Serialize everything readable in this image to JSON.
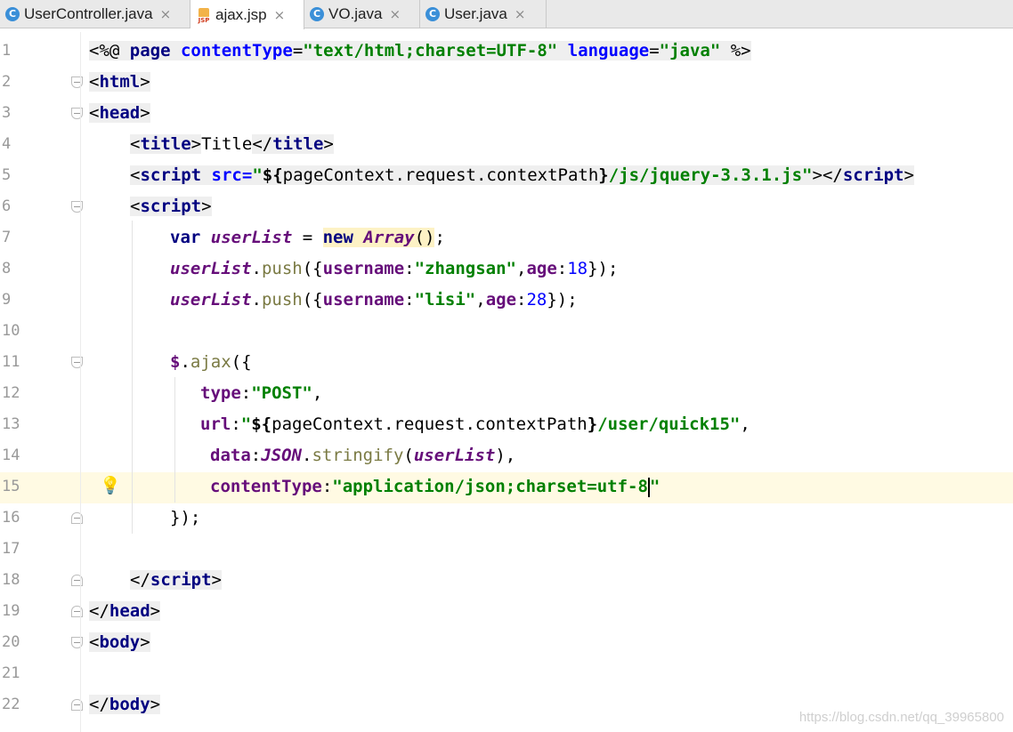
{
  "tabs": [
    {
      "label": "UserController.java",
      "icon": "java-class-icon",
      "active": false
    },
    {
      "label": "ajax.jsp",
      "icon": "jsp-file-icon",
      "active": true
    },
    {
      "label": "VO.java",
      "icon": "java-class-icon",
      "active": false
    },
    {
      "label": "User.java",
      "icon": "java-class-icon",
      "active": false
    }
  ],
  "line_numbers": [
    "1",
    "2",
    "3",
    "4",
    "5",
    "6",
    "7",
    "8",
    "9",
    "10",
    "11",
    "12",
    "13",
    "14",
    "15",
    "16",
    "17",
    "18",
    "19",
    "20",
    "21",
    "22"
  ],
  "code": {
    "l1": {
      "open": "<%@ ",
      "page": "page ",
      "attr1": "contentType",
      "eq1": "=",
      "val1": "\"text/html;charset=UTF-8\"",
      "attr2": " language",
      "eq2": "=",
      "val2": "\"java\"",
      "close": " %>"
    },
    "l2": {
      "lt": "<",
      "tag": "html",
      "gt": ">"
    },
    "l3": {
      "lt": "<",
      "tag": "head",
      "gt": ">"
    },
    "l4": {
      "lt": "<",
      "tag": "title",
      "gt": ">",
      "text": "Title",
      "lt2": "</",
      "tag2": "title",
      "gt2": ">"
    },
    "l5": {
      "lt": "<",
      "tag": "script",
      "attr": " src",
      "eq": "=",
      "q1": "\"",
      "el": "${",
      "elbody": "pageContext.request.contextPath",
      "elend": "}",
      "path": "/js/jquery-3.3.1.js\"",
      "gt": ">",
      "lt2": "</",
      "tag2": "script",
      "gt2": ">"
    },
    "l6": {
      "lt": "<",
      "tag": "script",
      "gt": ">"
    },
    "l7": {
      "kw": "var ",
      "v": "userList",
      "eq": " = ",
      "new": "new ",
      "cls": "Array",
      "paren": "()",
      "semi": ";"
    },
    "l8": {
      "v": "userList",
      "dot": ".",
      "fn": "push",
      "open": "({",
      "k1": "username",
      "c1": ":",
      "s1": "\"zhangsan\"",
      "comma": ",",
      "k2": "age",
      "c2": ":",
      "n": "18",
      "close": "});"
    },
    "l9": {
      "v": "userList",
      "dot": ".",
      "fn": "push",
      "open": "({",
      "k1": "username",
      "c1": ":",
      "s1": "\"lisi\"",
      "comma": ",",
      "k2": "age",
      "c2": ":",
      "n": "28",
      "close": "});"
    },
    "l11": {
      "dollar": "$",
      "dot": ".",
      "fn": "ajax",
      "open": "({"
    },
    "l12": {
      "k": "type",
      "c": ":",
      "s": "\"POST\"",
      "comma": ","
    },
    "l13": {
      "k": "url",
      "c": ":",
      "q": "\"",
      "el": "${",
      "elbody": "pageContext.request.contextPath",
      "elend": "}",
      "path": "/user/quick15\"",
      "comma": ","
    },
    "l14": {
      "k": "data",
      "c": ":",
      "obj": "JSON",
      "dot": ".",
      "fn": "stringify",
      "open": "(",
      "v": "userList",
      "close": "),"
    },
    "l15": {
      "k": "contentType",
      "c": ":",
      "s": "\"application/json;charset=utf-8",
      "q": "\""
    },
    "l16": {
      "close": "});"
    },
    "l18": {
      "lt": "</",
      "tag": "script",
      "gt": ">"
    },
    "l19": {
      "lt": "</",
      "tag": "head",
      "gt": ">"
    },
    "l20": {
      "lt": "<",
      "tag": "body",
      "gt": ">"
    },
    "l22": {
      "lt": "</",
      "tag": "body",
      "gt": ">"
    }
  },
  "watermark": "https://blog.csdn.net/qq_39965800",
  "colors": {
    "tag": "#000080",
    "string": "#008000",
    "attribute": "#0000ff",
    "variable": "#660e7a",
    "current_line": "#fffae3"
  }
}
